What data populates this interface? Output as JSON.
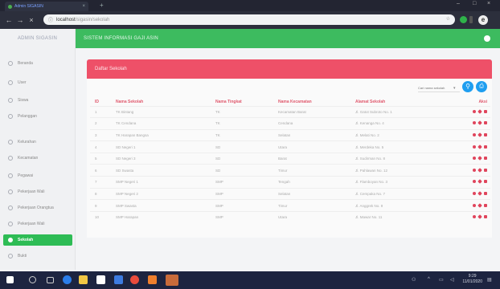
{
  "browser": {
    "tab_title": "Admin SIGASIN",
    "url_host": "localhost",
    "url_path": "/sigasin/sekolah"
  },
  "sidebar": {
    "brand": "ADMIN SIGASIN",
    "items": [
      {
        "label": "Beranda",
        "active": false
      },
      {
        "label": "User",
        "active": false
      },
      {
        "label": "Siswa",
        "active": false
      },
      {
        "label": "Pelanggan",
        "active": false
      },
      {
        "label": "Kelurahan",
        "active": false
      },
      {
        "label": "Kecamatan",
        "active": false
      },
      {
        "label": "Pegawai",
        "active": false
      },
      {
        "label": "Pekerjaan Wali",
        "active": false
      },
      {
        "label": "Pekerjaan Orangtua",
        "active": false
      },
      {
        "label": "Pekerjaan Wali",
        "active": false
      },
      {
        "label": "Sekolah",
        "active": true
      },
      {
        "label": "Bukti",
        "active": false
      }
    ]
  },
  "header": {
    "title": "SISTEM INFORMASI GAJI ASIN"
  },
  "card": {
    "title": "Daftar Sekolah",
    "search_placeholder": "Cari nama sekolah",
    "columns": [
      "ID",
      "Nama Sekolah",
      "Nama Tingkat",
      "Nama Kecamatan",
      "Alamat Sekolah",
      "Aksi"
    ],
    "rows": [
      [
        "1",
        "TK Bintang",
        "TK",
        "Kecamatan Barat",
        "Jl. Gatot Subroto No. 1",
        ""
      ],
      [
        "2",
        "TK Cendana",
        "TK",
        "Cendana",
        "Jl. Kenanga No. 4",
        ""
      ],
      [
        "3",
        "TK Harapan Bangsa",
        "TK",
        "Selatan",
        "Jl. Melati No. 2",
        ""
      ],
      [
        "4",
        "SD Negeri 1",
        "SD",
        "Utara",
        "Jl. Merdeka No. 5",
        ""
      ],
      [
        "5",
        "SD Negeri 3",
        "SD",
        "Barat",
        "Jl. Sudirman No. 8",
        ""
      ],
      [
        "6",
        "SD Swasta",
        "SD",
        "Timur",
        "Jl. Pahlawan No. 12",
        ""
      ],
      [
        "7",
        "SMP Negeri 1",
        "SMP",
        "Tengah",
        "Jl. Flamboyan No. 3",
        ""
      ],
      [
        "8",
        "SMP Negeri 2",
        "SMP",
        "Selatan",
        "Jl. Cempaka No. 7",
        ""
      ],
      [
        "9",
        "SMP Swasta",
        "SMP",
        "Timur",
        "Jl. Anggrek No. 9",
        ""
      ],
      [
        "10",
        "SMP Harapan",
        "SMP",
        "Utara",
        "Jl. Mawar No. 11",
        ""
      ]
    ]
  },
  "taskbar": {
    "time": "9:29",
    "date": "11/01/2020"
  },
  "colors": {
    "header_green": "#3dbb5f",
    "card_red": "#ee5068",
    "accent_blue": "#1f9ef0",
    "active_green": "#2ebc55"
  }
}
